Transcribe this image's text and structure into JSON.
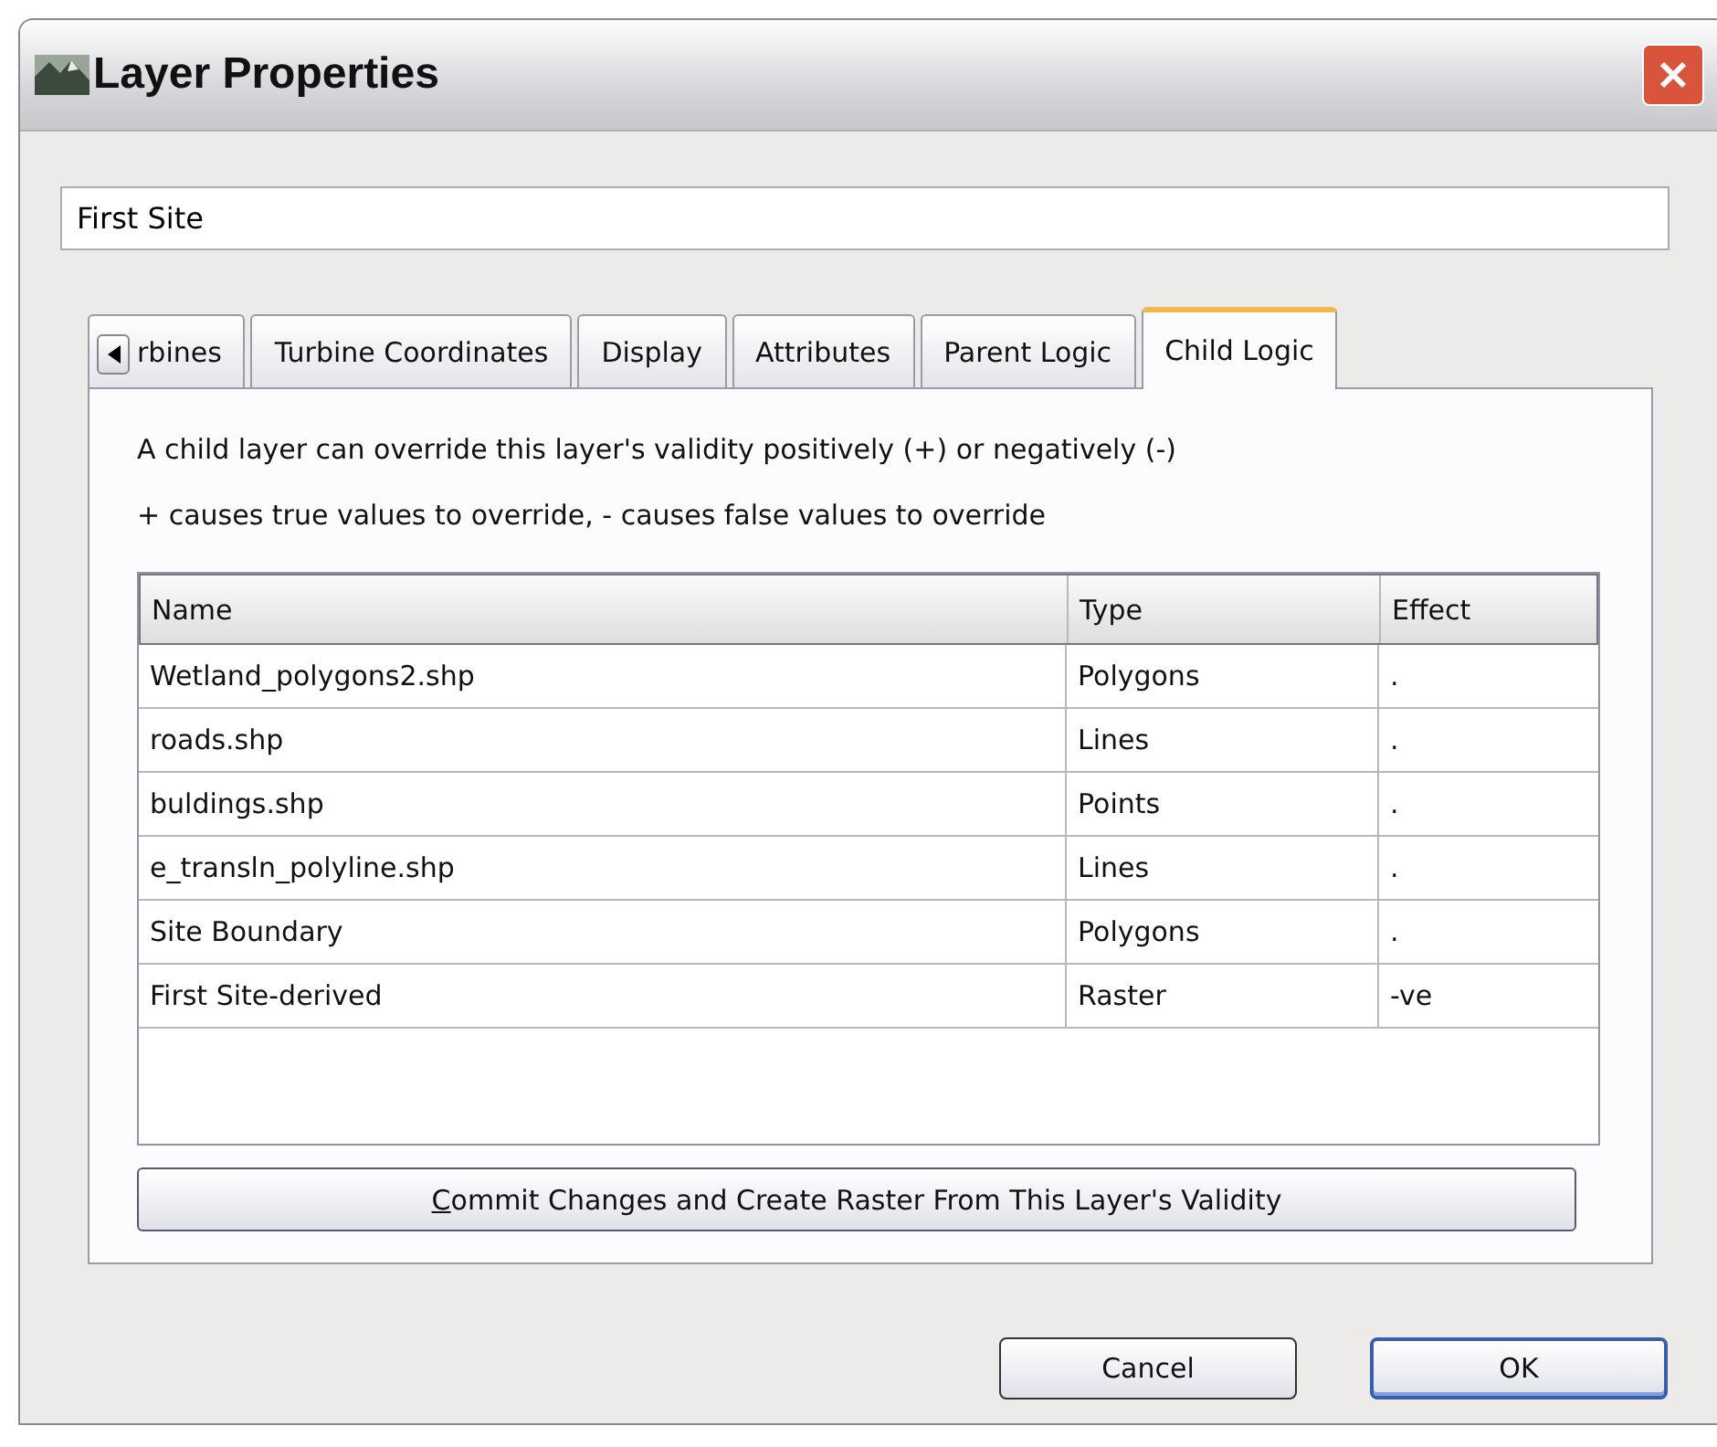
{
  "window": {
    "title": "Layer Properties"
  },
  "name_field": {
    "value": "First Site"
  },
  "tabs": [
    {
      "label": "rbines",
      "selected": false
    },
    {
      "label": "Turbine Coordinates",
      "selected": false
    },
    {
      "label": "Display",
      "selected": false
    },
    {
      "label": "Attributes",
      "selected": false
    },
    {
      "label": "Parent Logic",
      "selected": false
    },
    {
      "label": "Child Logic",
      "selected": true
    }
  ],
  "description": [
    "A child layer can override this layer's validity positively (+) or negatively (-)",
    "+ causes true values to override, - causes false values to override"
  ],
  "table": {
    "columns": [
      "Name",
      "Type",
      "Effect"
    ],
    "rows": [
      [
        "Wetland_polygons2.shp",
        "Polygons",
        "."
      ],
      [
        "roads.shp",
        "Lines",
        "."
      ],
      [
        "buldings.shp",
        "Points",
        "."
      ],
      [
        "e_transln_polyline.shp",
        "Lines",
        "."
      ],
      [
        "Site Boundary",
        "Polygons",
        "."
      ],
      [
        "First Site-derived",
        "Raster",
        "-ve"
      ]
    ]
  },
  "commit_button": "Commit Changes and Create Raster From This Layer's Validity",
  "buttons": [
    {
      "label": "Cancel",
      "kind": "normal"
    },
    {
      "label": "OK",
      "kind": "default"
    }
  ]
}
